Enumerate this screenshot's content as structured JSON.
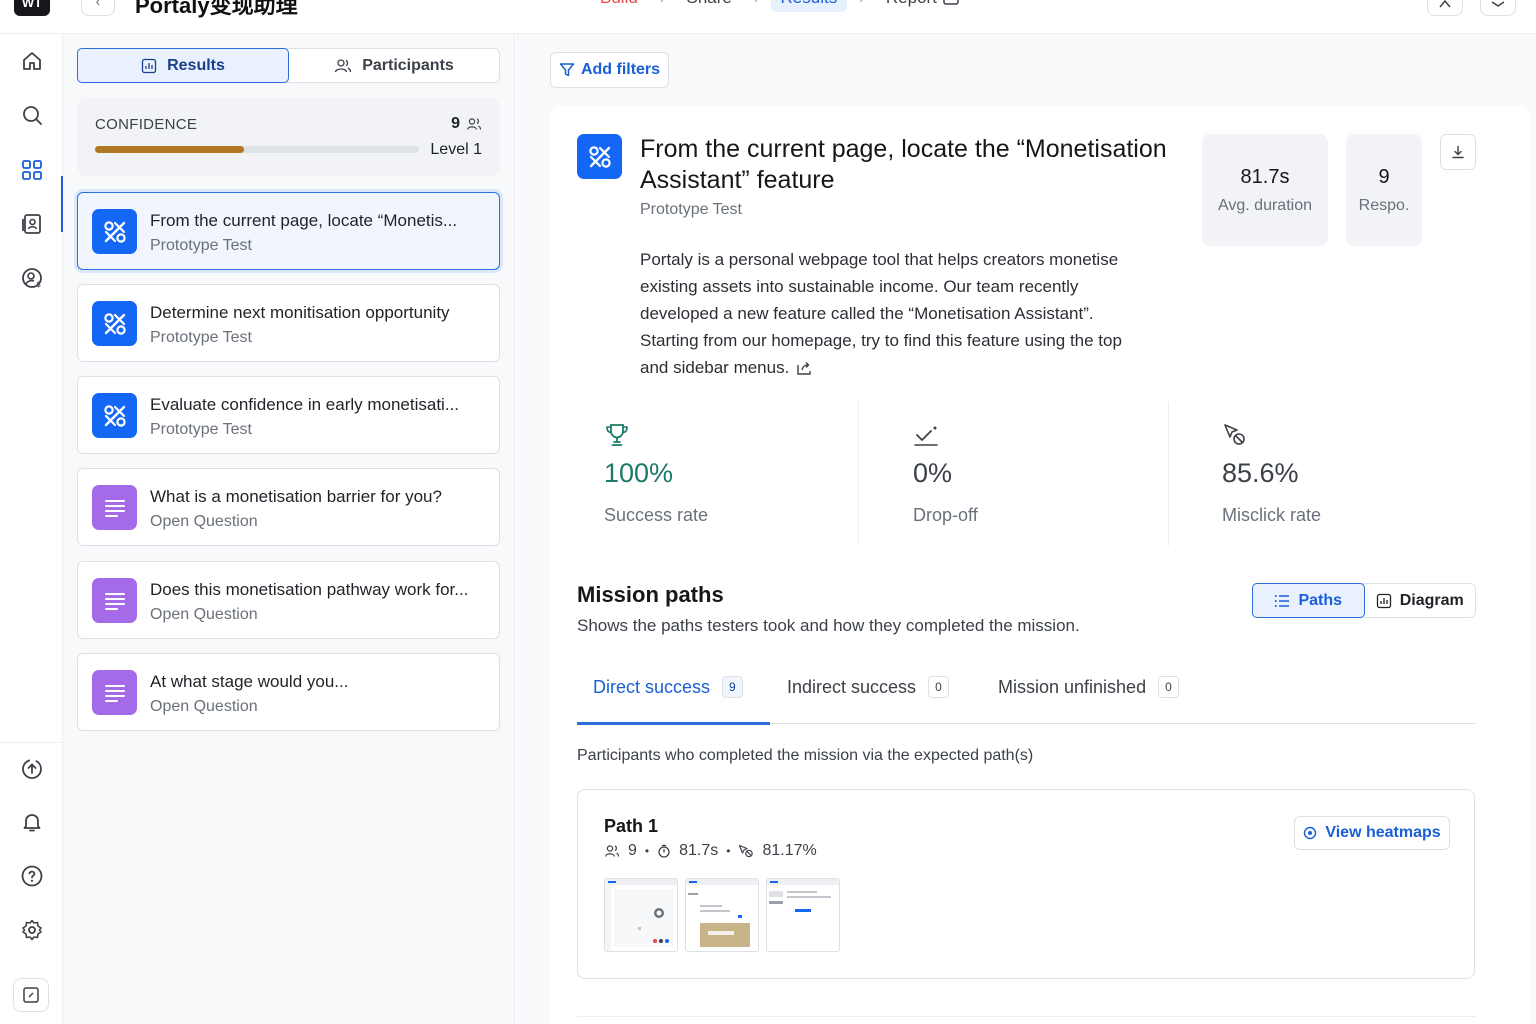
{
  "header": {
    "logo_text": "WT",
    "project_title": "Portaly变现助理",
    "breadcrumbs": [
      {
        "label": "Build"
      },
      {
        "label": "Share"
      },
      {
        "label": "Results"
      },
      {
        "label": "Report"
      }
    ]
  },
  "left_panel": {
    "tabs": [
      {
        "label": "Results",
        "icon": "chart-icon",
        "active": true
      },
      {
        "label": "Participants",
        "icon": "users-icon",
        "active": false
      }
    ],
    "confidence": {
      "label": "CONFIDENCE",
      "count": "9",
      "level": "Level 1",
      "progress": 0.46
    },
    "tasks": [
      {
        "title": "From the current page, locate “Monetis...",
        "type": "Prototype Test",
        "icon": "prototype-icon",
        "selected": true
      },
      {
        "title": "Determine next monitisation opportunity",
        "type": "Prototype Test",
        "icon": "prototype-icon",
        "selected": false
      },
      {
        "title": "Evaluate confidence in early monetisati...",
        "type": "Prototype Test",
        "icon": "prototype-icon",
        "selected": false
      },
      {
        "title": "What is a monetisation barrier for you?",
        "type": "Open Question",
        "icon": "text-lines-icon",
        "selected": false
      },
      {
        "title": "Does this monetisation pathway work for...",
        "type": "Open Question",
        "icon": "text-lines-icon",
        "selected": false
      },
      {
        "title": "At what stage would you...",
        "type": "Open Question",
        "icon": "text-lines-icon",
        "selected": false
      }
    ]
  },
  "main": {
    "add_filters": "Add filters",
    "mission": {
      "title": "From the current page, locate the “Monetisation Assistant” feature",
      "type": "Prototype Test",
      "description": [
        "Portaly is a personal webpage tool that helps creators monetise",
        "existing assets into sustainable income. Our team recently",
        "developed a new feature called the “Monetisation Assistant”.",
        "Starting from our homepage, try to find this feature using the top",
        "and sidebar menus."
      ],
      "stats": [
        {
          "value": "81.7s",
          "label": "Avg. duration"
        },
        {
          "value": "9",
          "label": "Respo."
        }
      ]
    },
    "metrics": [
      {
        "value": "100%",
        "label": "Success rate",
        "icon": "trophy-icon",
        "color": "#1b7a6a"
      },
      {
        "value": "0%",
        "label": "Drop-off",
        "icon": "drop-off-icon",
        "color": "#3c4149"
      },
      {
        "value": "85.6%",
        "label": "Misclick rate",
        "icon": "misclick-icon",
        "color": "#3c4149"
      }
    ],
    "paths": {
      "title": "Mission paths",
      "subtitle": "Shows the paths testers took and how they completed the mission.",
      "view_toggle": [
        {
          "label": "Paths",
          "active": true
        },
        {
          "label": "Diagram",
          "active": false
        }
      ],
      "tabs": [
        {
          "label": "Direct success",
          "count": "9",
          "active": true
        },
        {
          "label": "Indirect success",
          "count": "0",
          "active": false
        },
        {
          "label": "Mission unfinished",
          "count": "0",
          "active": false
        }
      ],
      "note": "Participants who completed the mission via the expected path(s)",
      "path_cards": [
        {
          "title": "Path 1",
          "participants": "9",
          "duration": "81.7s",
          "misclick": "81.17%",
          "heatmap_button": "View heatmaps"
        }
      ]
    }
  },
  "colors": {
    "accent": "#1a5fd6",
    "prototype_icon_bg": "#1466f5",
    "question_icon_bg": "#a56ae8",
    "confidence_bar": "#b07824",
    "success": "#1b7a6a"
  }
}
